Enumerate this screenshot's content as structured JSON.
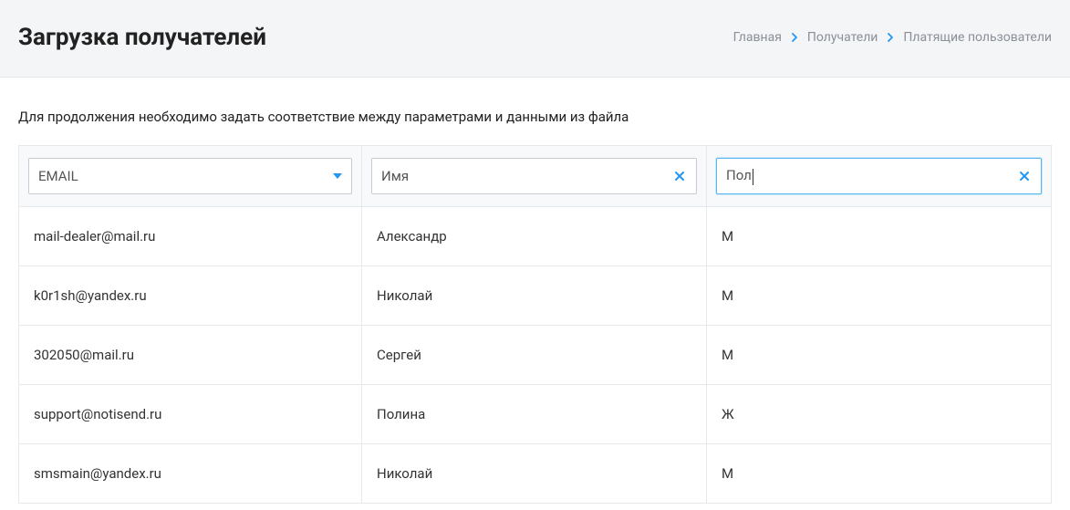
{
  "header": {
    "title": "Загрузка получателей"
  },
  "breadcrumbs": {
    "items": [
      "Главная",
      "Получатели",
      "Платящие пользователи"
    ]
  },
  "intro": "Для продолжения необходимо задать соответствие между параметрами и данными из файла",
  "columns": {
    "col1": {
      "type": "select",
      "value": "EMAIL"
    },
    "col2": {
      "type": "text",
      "value": "Имя"
    },
    "col3": {
      "type": "text",
      "value": "Пол",
      "focused": true
    }
  },
  "rows": [
    {
      "c1": "mail-dealer@mail.ru",
      "c2": "Александр",
      "c3": "М"
    },
    {
      "c1": "k0r1sh@yandex.ru",
      "c2": "Николай",
      "c3": "М"
    },
    {
      "c1": "302050@mail.ru",
      "c2": "Сергей",
      "c3": "М"
    },
    {
      "c1": "support@notisend.ru",
      "c2": "Полина",
      "c3": "Ж"
    },
    {
      "c1": "smsmain@yandex.ru",
      "c2": "Николай",
      "c3": "М"
    }
  ]
}
